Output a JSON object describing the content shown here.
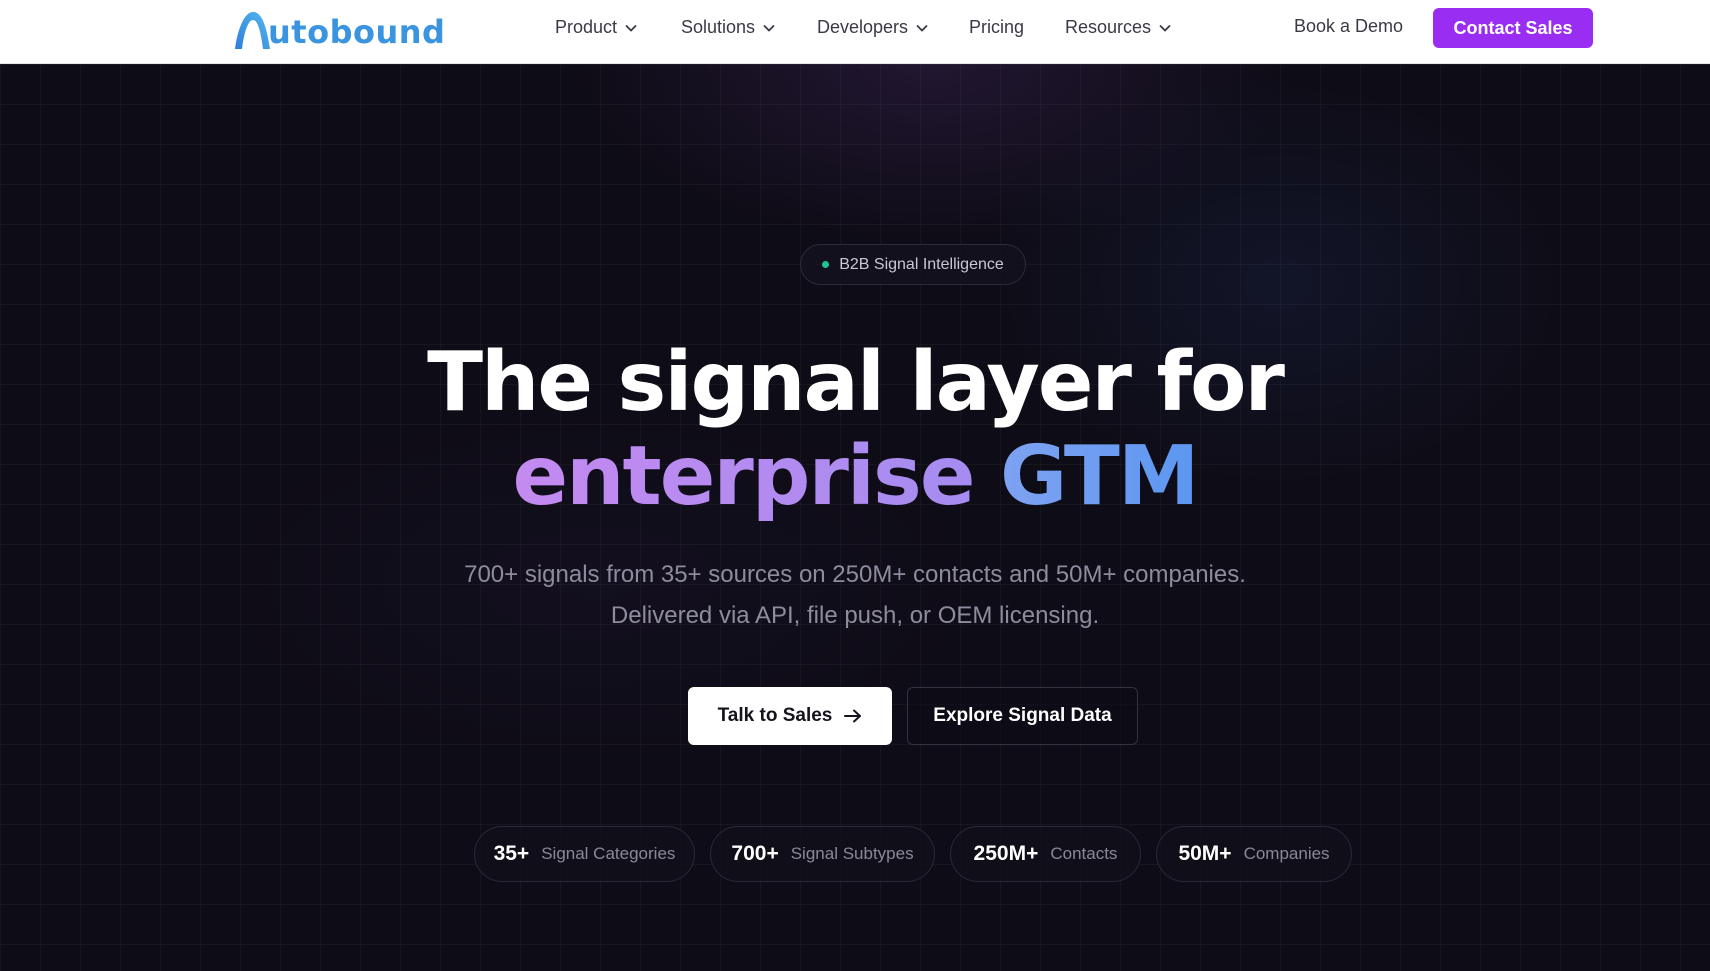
{
  "brand": {
    "logo_text": "utobound",
    "logo_color": "#3a94e0"
  },
  "nav": {
    "items": [
      {
        "label": "Product",
        "has_dropdown": true
      },
      {
        "label": "Solutions",
        "has_dropdown": true
      },
      {
        "label": "Developers",
        "has_dropdown": true
      },
      {
        "label": "Pricing",
        "has_dropdown": false
      },
      {
        "label": "Resources",
        "has_dropdown": true
      }
    ],
    "book_demo": "Book a Demo",
    "contact_sales": "Contact Sales"
  },
  "hero": {
    "badge": "B2B Signal Intelligence",
    "headline_line1": "The signal layer for",
    "headline_word_purple": "enterprise",
    "headline_word_blue": "GTM",
    "subtitle_line1": "700+ signals from 35+ sources on 250M+ contacts and 50M+ companies.",
    "subtitle_line2": "Delivered via API, file push, or OEM licensing.",
    "cta_primary": "Talk to Sales",
    "cta_secondary": "Explore Signal Data",
    "stats": [
      {
        "value": "35+",
        "label": "Signal Categories"
      },
      {
        "value": "700+",
        "label": "Signal Subtypes"
      },
      {
        "value": "250M+",
        "label": "Contacts"
      },
      {
        "value": "50M+",
        "label": "Companies"
      }
    ]
  },
  "colors": {
    "accent_purple": "#9a2df2",
    "badge_dot": "#22c38e",
    "background": "#0e0c16"
  }
}
